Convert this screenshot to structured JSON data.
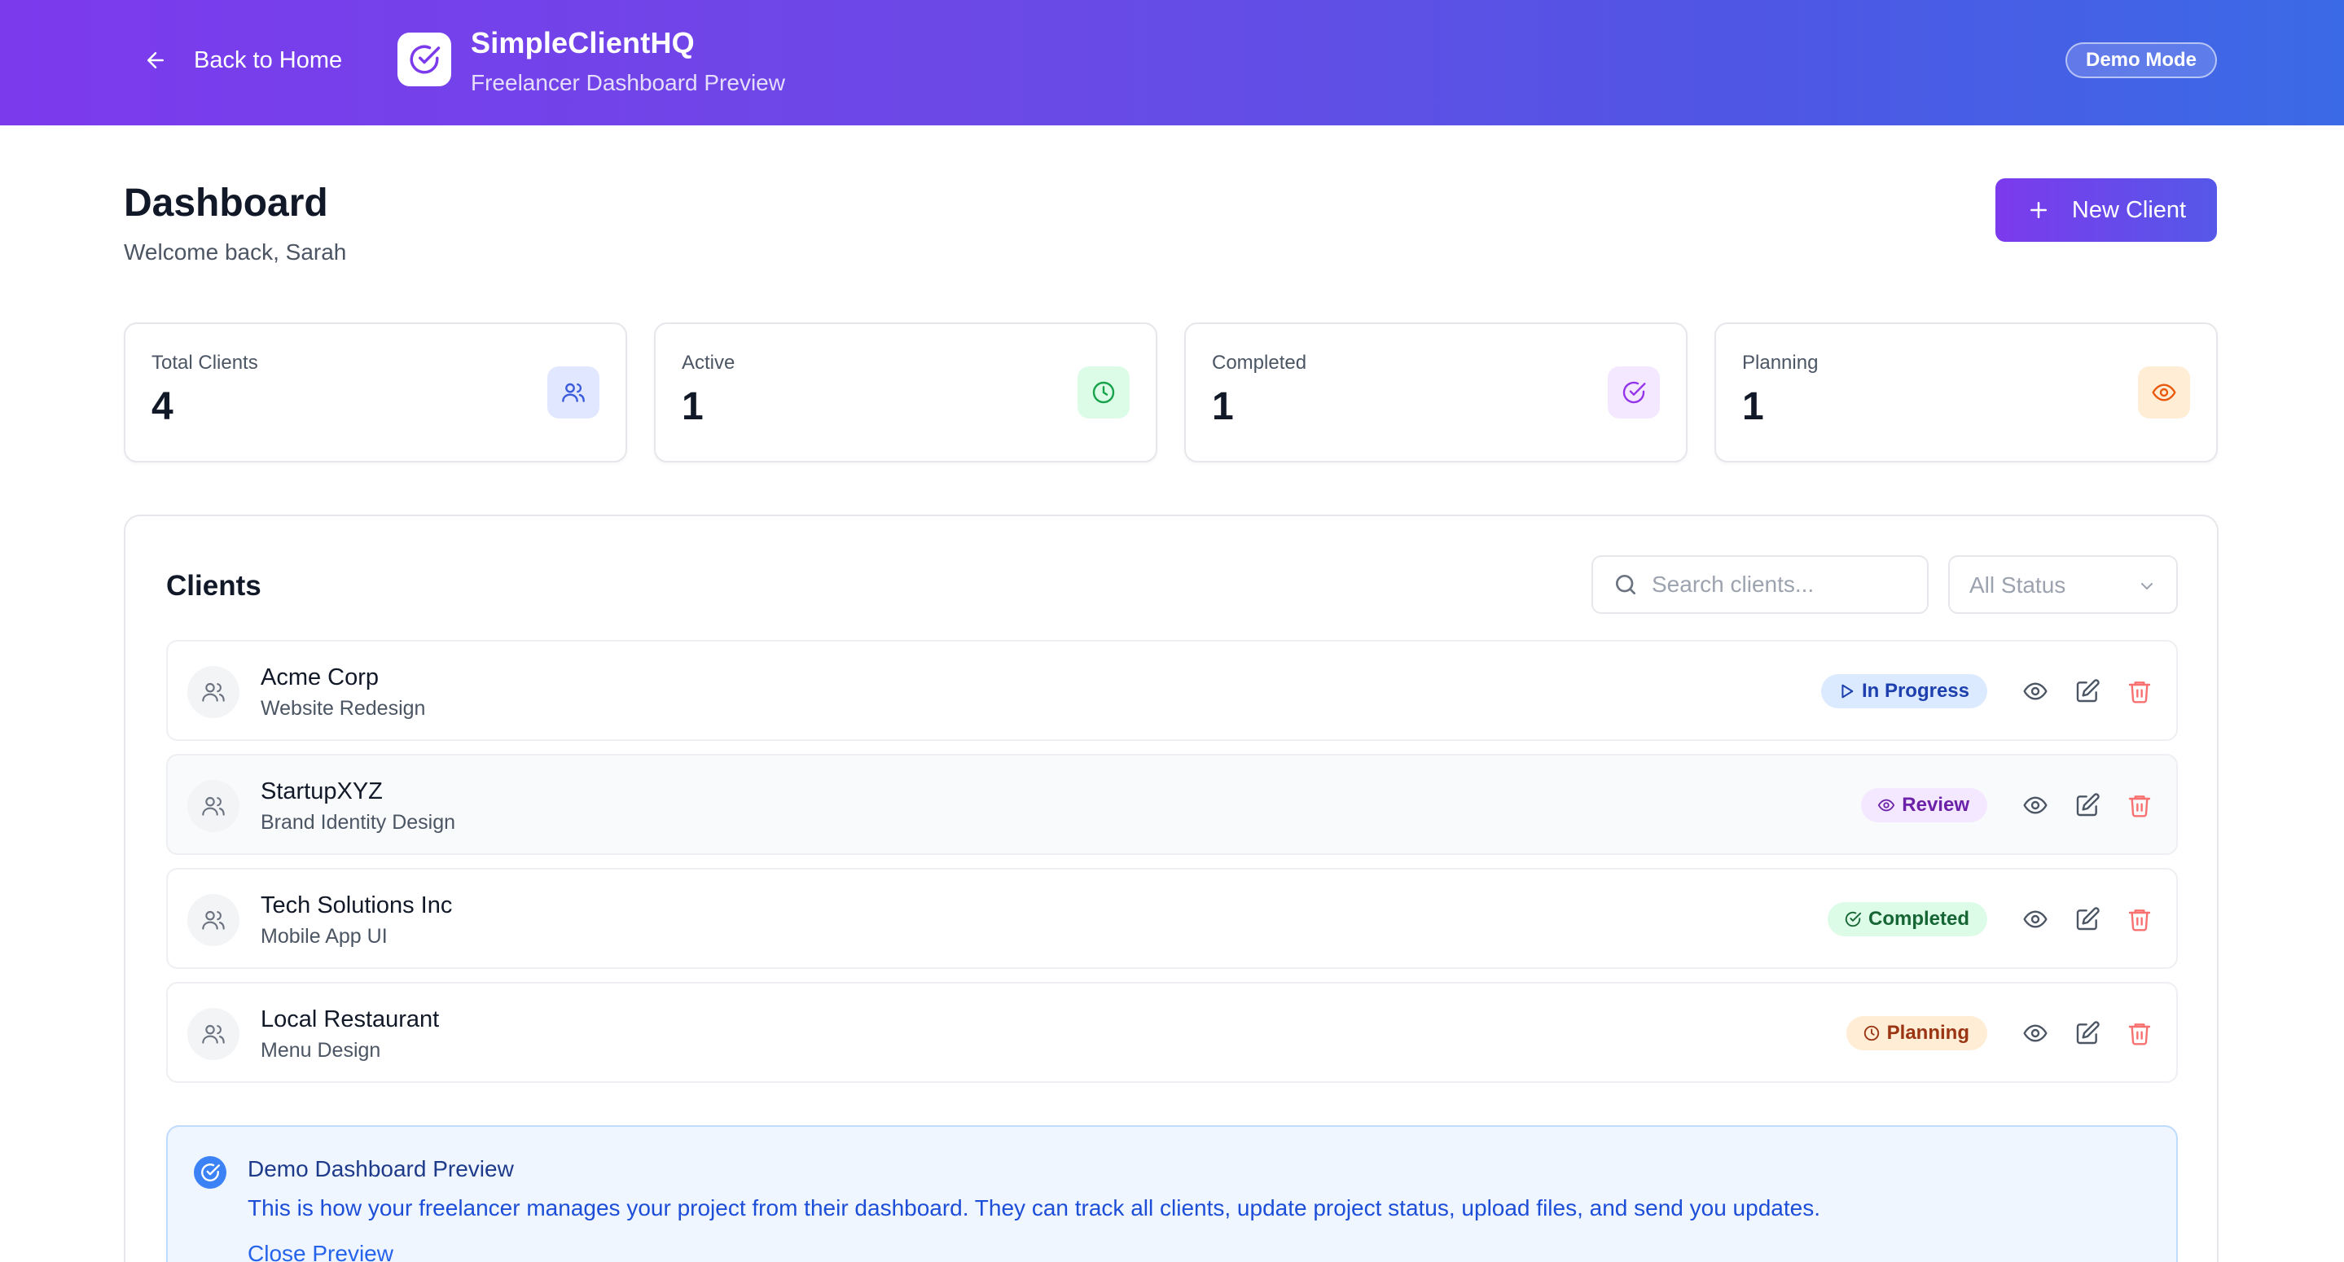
{
  "header": {
    "back_label": "Back to Home",
    "brand_title": "SimpleClientHQ",
    "brand_subtitle": "Freelancer Dashboard Preview",
    "mode_badge": "Demo Mode"
  },
  "page": {
    "title": "Dashboard",
    "subtitle": "Welcome back, Sarah",
    "new_client_label": "New Client"
  },
  "stats": [
    {
      "label": "Total Clients",
      "value": "4",
      "icon": "users-icon",
      "icon_color": "#3b5bdb",
      "icon_bg": "#e0e7ff"
    },
    {
      "label": "Active",
      "value": "1",
      "icon": "clock-icon",
      "icon_color": "#16a34a",
      "icon_bg": "#dcfce7"
    },
    {
      "label": "Completed",
      "value": "1",
      "icon": "check-circle-icon",
      "icon_color": "#9333ea",
      "icon_bg": "#f3e8ff"
    },
    {
      "label": "Planning",
      "value": "1",
      "icon": "eye-icon",
      "icon_color": "#ea580c",
      "icon_bg": "#ffedd5"
    }
  ],
  "clients_panel": {
    "title": "Clients",
    "search_placeholder": "Search clients...",
    "status_filter": "All Status",
    "rows": [
      {
        "name": "Acme Corp",
        "project": "Website Redesign",
        "status": "In Progress",
        "status_icon": "play-icon",
        "status_color": "#1e40af",
        "status_bg": "#dbeafe"
      },
      {
        "name": "StartupXYZ",
        "project": "Brand Identity Design",
        "status": "Review",
        "status_icon": "eye-icon",
        "status_color": "#6b21a8",
        "status_bg": "#f3e8ff"
      },
      {
        "name": "Tech Solutions Inc",
        "project": "Mobile App UI",
        "status": "Completed",
        "status_icon": "check-circle-icon",
        "status_color": "#166534",
        "status_bg": "#dcfce7"
      },
      {
        "name": "Local Restaurant",
        "project": "Menu Design",
        "status": "Planning",
        "status_icon": "clock-icon",
        "status_color": "#9a3412",
        "status_bg": "#ffedd5"
      }
    ]
  },
  "notice": {
    "title": "Demo Dashboard Preview",
    "text": "This is how your freelancer manages your project from their dashboard. They can track all clients, update project status, upload files, and send you updates.",
    "close_label": "Close Preview"
  },
  "colors": {
    "accent_purple": "#7c3aed",
    "accent_blue": "#3b6ae6",
    "delete_red": "#f87171"
  }
}
